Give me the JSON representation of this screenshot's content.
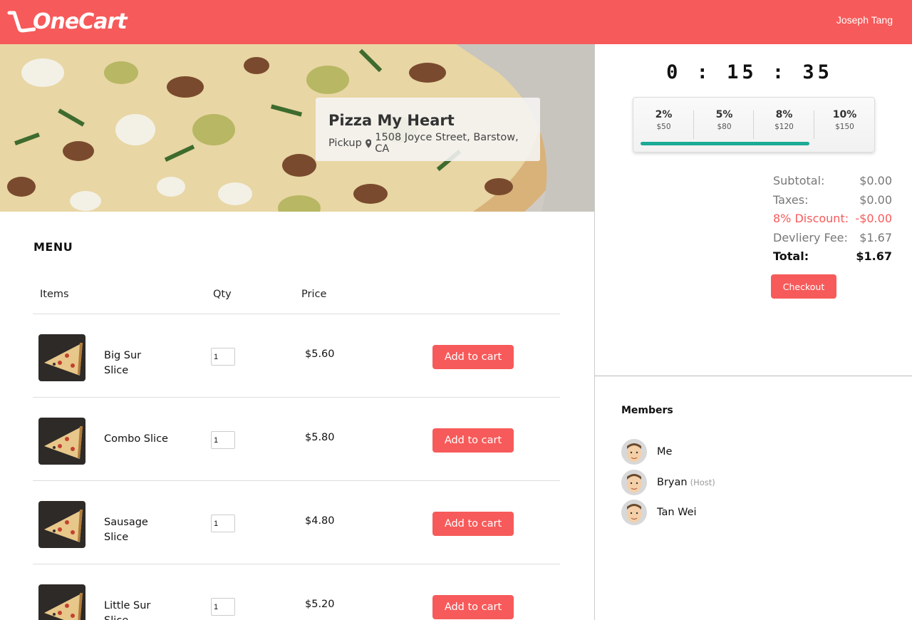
{
  "header": {
    "brand": "OneCart",
    "user_name": "Joseph Tang"
  },
  "store": {
    "name": "Pizza My Heart",
    "mode": "Pickup",
    "address": "1508 Joyce Street, Barstow, CA"
  },
  "menu": {
    "title": "MENU",
    "columns": {
      "items": "Items",
      "qty": "Qty",
      "price": "Price"
    },
    "add_label": "Add to cart",
    "items": [
      {
        "name": "Big Sur Slice",
        "qty": "1",
        "price": "$5.60"
      },
      {
        "name": "Combo Slice",
        "qty": "1",
        "price": "$5.80"
      },
      {
        "name": "Sausage Slice",
        "qty": "1",
        "price": "$4.80"
      },
      {
        "name": "Little Sur Slice",
        "qty": "1",
        "price": "$5.20"
      }
    ]
  },
  "timer": "0 : 15 : 35",
  "discount_tiers": {
    "tiers": [
      {
        "pct": "2%",
        "amount": "$50"
      },
      {
        "pct": "5%",
        "amount": "$80"
      },
      {
        "pct": "8%",
        "amount": "$120"
      },
      {
        "pct": "10%",
        "amount": "$150"
      }
    ],
    "progress_fraction": 0.74,
    "progress_color": "#1aaa96"
  },
  "summary": {
    "subtotal_label": "Subtotal:",
    "subtotal": "$0.00",
    "taxes_label": "Taxes:",
    "taxes": "$0.00",
    "discount_label": "8% Discount:",
    "discount": "-$0.00",
    "delivery_label": "Devliery Fee:",
    "delivery": "$1.67",
    "total_label": "Total:",
    "total": "$1.67",
    "checkout_label": "Checkout"
  },
  "members": {
    "title": "Members",
    "list": [
      {
        "name": "Me",
        "tag": ""
      },
      {
        "name": "Bryan",
        "tag": "(Host)"
      },
      {
        "name": "Tan Wei",
        "tag": ""
      }
    ]
  },
  "colors": {
    "brand": "#f75a5a",
    "progress": "#1aaa96"
  }
}
